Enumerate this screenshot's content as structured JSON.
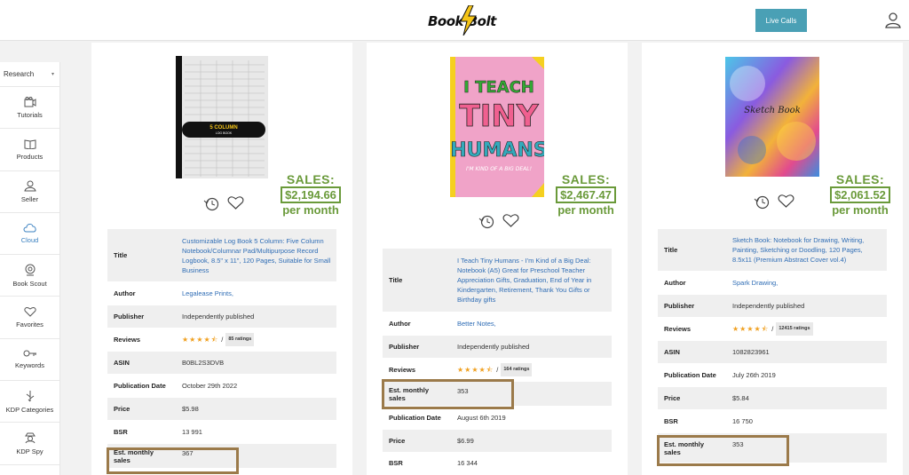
{
  "header": {
    "logo_text": "Book Bolt",
    "live_calls": "Live Calls"
  },
  "sidebar": {
    "select": "Research",
    "items": [
      {
        "label": "Tutorials",
        "icon": "video-icon"
      },
      {
        "label": "Products",
        "icon": "book-icon"
      },
      {
        "label": "Seller",
        "icon": "seller-icon"
      },
      {
        "label": "Cloud",
        "icon": "cloud-icon"
      },
      {
        "label": "Book Scout",
        "icon": "scout-icon"
      },
      {
        "label": "Favorites",
        "icon": "heart-icon"
      },
      {
        "label": "Keywords",
        "icon": "key-icon"
      },
      {
        "label": "KDP Categories",
        "icon": "categories-icon"
      },
      {
        "label": "KDP Spy",
        "icon": "spy-icon"
      }
    ]
  },
  "colors": {
    "sales_green": "#6a9a3a",
    "highlight": "#9b7a4a",
    "link": "#2f6db5",
    "accent": "#4aa0b5"
  },
  "cards": [
    {
      "cover_text": "5 COLUMN",
      "cover_subtext": "LOG BOOK",
      "sales_label": "SALES:",
      "sales_amount": "$2,194.66",
      "sales_period": "per month",
      "title_label": "Title",
      "title": "Customizable Log Book 5 Column: Five Column Notebook/Columnar Pad/Multipurpose Record Logbook, 8.5\" x 11\", 120 Pages, Suitable for Small Business",
      "author_label": "Author",
      "author": "Legalease Prints,",
      "publisher_label": "Publisher",
      "publisher": "Independently published",
      "reviews_label": "Reviews",
      "stars": "★★★★⯪",
      "ratings": "85 ratings",
      "asin_label": "ASIN",
      "asin": "B0BL2S3DVB",
      "pubdate_label": "Publication Date",
      "pubdate": "October 29th 2022",
      "price_label": "Price",
      "price": "$5.98",
      "bsr_label": "BSR",
      "bsr": "13 991",
      "monthly_label": "Est. monthly sales",
      "monthly": "367"
    },
    {
      "cover_line1": "I TEACH",
      "cover_line2": "TINY",
      "cover_line3": "HUMANS",
      "cover_tag": "I'M KIND OF A BIG DEAL!",
      "sales_label": "SALES:",
      "sales_amount": "$2,467.47",
      "sales_period": "per month",
      "title_label": "Title",
      "title": "I Teach Tiny Humans - I'm Kind of a Big Deal: Notebook (A5) Great for Preschool Teacher Appreciation Gifts, Graduation, End of Year in Kindergarten, Retirement, Thank You Gifts or Birthday gifts",
      "author_label": "Author",
      "author": "Better Notes,",
      "publisher_label": "Publisher",
      "publisher": "Independently published",
      "reviews_label": "Reviews",
      "stars": "★★★★⯪",
      "ratings": "164 ratings",
      "monthly_label": "Est. monthly sales",
      "monthly": "353",
      "pubdate_label": "Publication Date",
      "pubdate": "August 6th 2019",
      "price_label": "Price",
      "price": "$6.99",
      "bsr_label": "BSR",
      "bsr": "16 344"
    },
    {
      "cover_text": "Sketch Book",
      "sales_label": "SALES:",
      "sales_amount": "$2,061.52",
      "sales_period": "per month",
      "title_label": "Title",
      "title": "Sketch Book: Notebook for Drawing, Writing, Painting, Sketching or Doodling, 120 Pages, 8.5x11 (Premium Abstract Cover vol.4)",
      "author_label": "Author",
      "author": "Spark Drawing,",
      "publisher_label": "Publisher",
      "publisher": "Independently published",
      "reviews_label": "Reviews",
      "stars": "★★★★⯪",
      "ratings": "12415 ratings",
      "asin_label": "ASIN",
      "asin": "1082823961",
      "pubdate_label": "Publication Date",
      "pubdate": "July 26th 2019",
      "price_label": "Price",
      "price": "$5.84",
      "bsr_label": "BSR",
      "bsr": "16 750",
      "monthly_label": "Est. monthly sales",
      "monthly": "353"
    }
  ]
}
